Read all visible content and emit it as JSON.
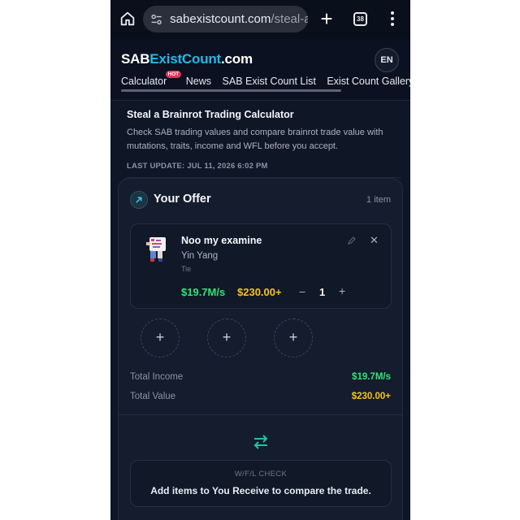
{
  "browser": {
    "url_host": "sabexistcount.com",
    "url_path": "/steal-a-",
    "tab_count": "38"
  },
  "site": {
    "logo_part1": "SAB",
    "logo_part2": "ExistCount",
    "logo_part3": ".com",
    "lang": "EN",
    "nav": [
      {
        "label": "Calculator",
        "badge": "HOT"
      },
      {
        "label": "News"
      },
      {
        "label": "SAB Exist Count List"
      },
      {
        "label": "Exist Count Gallery"
      }
    ]
  },
  "intro": {
    "title": "Steal a Brainrot Trading Calculator",
    "description": "Check SAB trading values and compare brainrot trade value with mutations, traits, income and WFL before you accept.",
    "last_update": "LAST UPDATE: JUL 11, 2026 6:02 PM"
  },
  "offer": {
    "title": "Your Offer",
    "count": "1 item",
    "item": {
      "name": "Noo my examine",
      "mutation": "Yin Yang",
      "trait": "Tie",
      "income": "$19.7M/s",
      "value": "$230.00+",
      "minus": "−",
      "quantity": "1",
      "plus": "+"
    },
    "slots": [
      "+",
      "+",
      "+"
    ],
    "totals": {
      "income_label": "Total Income",
      "income_value": "$19.7M/s",
      "value_label": "Total Value",
      "value_value": "$230.00+"
    }
  },
  "wfl": {
    "title": "W/F/L CHECK",
    "message": "Add items to You Receive to compare the trade."
  },
  "colors": {
    "accent": "#25b9e6",
    "income_green": "#2ee577",
    "value_gold": "#f5c518",
    "hot_badge": "#e0335a",
    "swap_icon": "#22c39a"
  }
}
